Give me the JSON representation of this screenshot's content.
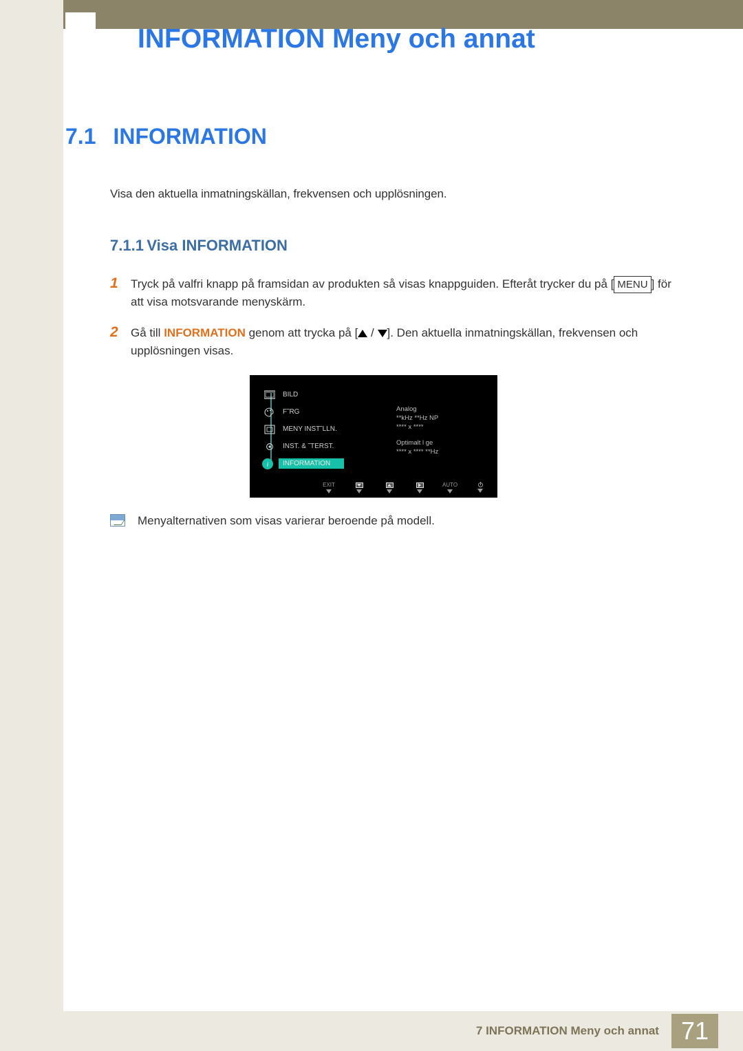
{
  "header": {
    "title": "INFORMATION Meny och annat"
  },
  "section": {
    "number": "7.1",
    "title": "INFORMATION"
  },
  "intro": "Visa den aktuella inmatningskällan, frekvensen och upplösningen.",
  "subsection": {
    "number": "7.1.1",
    "title": "Visa INFORMATION"
  },
  "steps": [
    {
      "num": "1",
      "text_a": "Tryck på valfri knapp på framsidan av produkten så visas knappguiden. Efteråt trycker du på [",
      "menu": "MENU",
      "text_b": "] för att visa motsvarande menyskärm."
    },
    {
      "num": "2",
      "text_a": "Gå till ",
      "highlight": "INFORMATION",
      "text_b": " genom att trycka på [",
      "text_c": "]. Den aktuella inmatningskällan, frekvensen och upplösningen visas."
    }
  ],
  "osd": {
    "items": [
      {
        "label": "BILD"
      },
      {
        "label": "F˜RG"
      },
      {
        "label": "MENY INST˜LLN."
      },
      {
        "label": "INST. & ˜TERST."
      },
      {
        "label": "INFORMATION",
        "selected": true
      }
    ],
    "right": {
      "line1": "Analog",
      "line2": "**kHz **Hz NP",
      "line3": "**** x ****",
      "line4": "Optimalt l ge",
      "line5": "**** x **** **Hz"
    },
    "footer": {
      "exit": "EXIT",
      "auto": "AUTO"
    }
  },
  "note": "Menyalternativen som visas varierar beroende på modell.",
  "footer": {
    "text": "7 INFORMATION Meny och annat",
    "page": "71"
  }
}
